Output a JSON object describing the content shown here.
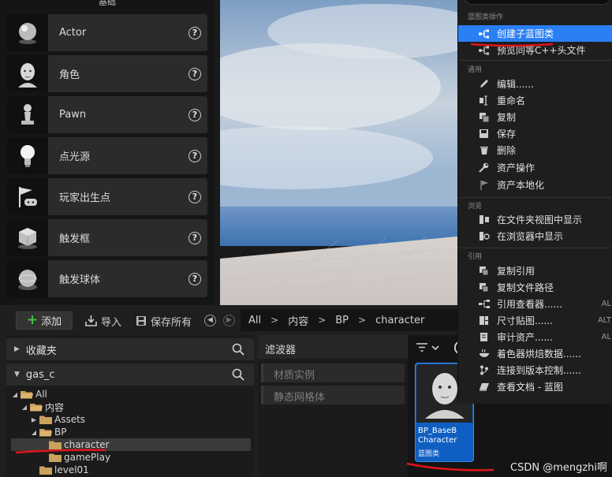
{
  "place_panel": {
    "header": "基础",
    "items": [
      {
        "label": "Actor",
        "icon": "sphere-icon"
      },
      {
        "label": "角色",
        "icon": "character-head-icon"
      },
      {
        "label": "Pawn",
        "icon": "pawn-icon"
      },
      {
        "label": "点光源",
        "icon": "light-bulb-icon"
      },
      {
        "label": "玩家出生点",
        "icon": "player-start-icon"
      },
      {
        "label": "触发框",
        "icon": "trigger-box-icon"
      },
      {
        "label": "触发球体",
        "icon": "trigger-sphere-icon"
      }
    ],
    "help_glyph": "?"
  },
  "content_browser": {
    "toolbar": {
      "add_label": "添加",
      "import_label": "导入",
      "save_all_label": "保存所有"
    },
    "breadcrumb": [
      "All",
      "内容",
      "BP",
      "character"
    ],
    "breadcrumb_sep": ">",
    "favorites_label": "收藏夹",
    "project_label": "gas_c",
    "tree": [
      {
        "label": "All",
        "depth": 0,
        "expanded": true
      },
      {
        "label": "内容",
        "depth": 1,
        "expanded": true
      },
      {
        "label": "Assets",
        "depth": 2,
        "expanded": false
      },
      {
        "label": "BP",
        "depth": 2,
        "expanded": true
      },
      {
        "label": "character",
        "depth": 3,
        "selected": true
      },
      {
        "label": "gamePlay",
        "depth": 3
      },
      {
        "label": "level01",
        "depth": 2
      }
    ],
    "filters_label": "滤波器",
    "filters": [
      "材质实例",
      "静态网格体"
    ],
    "asset": {
      "name_line1": "BP_BaseB",
      "name_line2": "Character",
      "type": "蓝图类"
    }
  },
  "context_menu": {
    "sections": [
      {
        "title": "蓝图类操作",
        "items": [
          {
            "label": "创建子蓝图类",
            "icon": "child-blueprint-icon",
            "highlighted": true
          },
          {
            "label": "预览同等C++头文件",
            "icon": "cpp-header-icon"
          }
        ]
      },
      {
        "title": "通用",
        "items": [
          {
            "label": "编辑......",
            "icon": "edit-pencil-icon"
          },
          {
            "label": "重命名",
            "icon": "rename-icon"
          },
          {
            "label": "复制",
            "icon": "duplicate-icon"
          },
          {
            "label": "保存",
            "icon": "save-icon"
          },
          {
            "label": "删除",
            "icon": "trash-icon"
          },
          {
            "label": "资产操作",
            "icon": "wrench-icon"
          },
          {
            "label": "资产本地化",
            "icon": "flag-icon"
          }
        ]
      },
      {
        "title": "浏览",
        "items": [
          {
            "label": "在文件夹视图中显示",
            "icon": "folder-view-icon"
          },
          {
            "label": "在浏览器中显示",
            "icon": "browser-icon"
          }
        ]
      },
      {
        "title": "引用",
        "items": [
          {
            "label": "复制引用",
            "icon": "copy-reference-icon"
          },
          {
            "label": "复制文件路径",
            "icon": "copy-path-icon"
          },
          {
            "label": "引用查看器......",
            "icon": "reference-viewer-icon",
            "shortcut": "AL"
          },
          {
            "label": "尺寸贴图......",
            "icon": "size-map-icon",
            "shortcut": "ALT"
          },
          {
            "label": "审计资产......",
            "icon": "audit-icon",
            "shortcut": "AL"
          },
          {
            "label": "着色器烘焙数据......",
            "icon": "shader-icon"
          },
          {
            "label": "连接到版本控制......",
            "icon": "source-control-icon"
          },
          {
            "label": "查看文档 - 蓝图",
            "icon": "documentation-icon"
          }
        ]
      }
    ]
  },
  "watermark": "CSDN @mengzhi啊",
  "colors": {
    "highlight": "#2b7ff5",
    "annotation_red": "#e0141b",
    "asset_card": "#0f5fc2"
  }
}
